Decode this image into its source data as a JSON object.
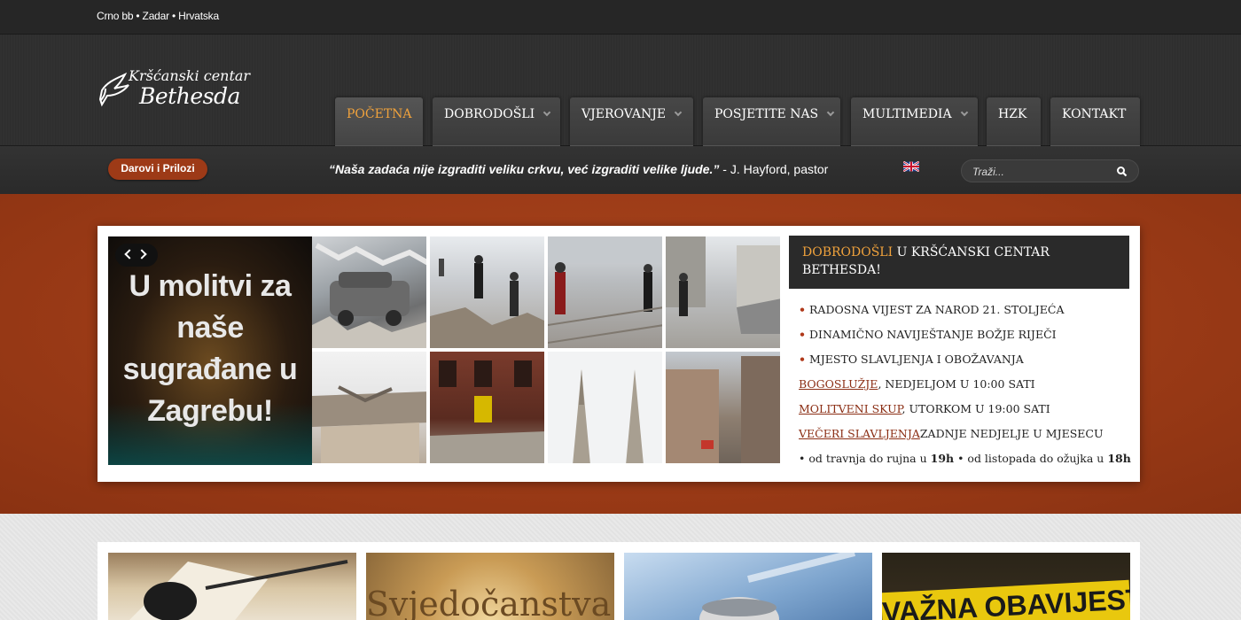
{
  "topbar": {
    "address": "Crno bb • Zadar • Hrvatska"
  },
  "logo": {
    "line1": "Kršćanski centar",
    "line2": "Bethesda"
  },
  "nav": [
    {
      "label": "POČETNA",
      "dropdown": false,
      "active": true
    },
    {
      "label": "DOBRODOŠLI",
      "dropdown": true
    },
    {
      "label": "VJEROVANJE",
      "dropdown": true
    },
    {
      "label": "POSJETITE NAS",
      "dropdown": true
    },
    {
      "label": "MULTIMEDIA",
      "dropdown": true
    },
    {
      "label": "HZK",
      "dropdown": false
    },
    {
      "label": "KONTAKT",
      "dropdown": false
    }
  ],
  "subbar": {
    "donate_label": "Darovi i Prilozi",
    "quote_text": "“Naša zadaća nije izgraditi veliku crkvu, već izgraditi velike ljude.”",
    "quote_author": " - J. Hayford, pastor",
    "language_icon": "uk-flag-icon",
    "search_placeholder": "Traži..."
  },
  "slider": {
    "caption": "U molitvi za naše sugrađane u Zagrebu!"
  },
  "welcome": {
    "title_highlight": "DOBRODOŠLI",
    "title_rest": " U KRŠĆANSKI CENTAR BETHESDA!"
  },
  "info": {
    "bullets": [
      "RADOSNA VIJEST ZA NAROD 21. STOLJEĆA",
      "DINAMIČNO NAVIJEŠTANJE BOŽJE RIJEČI",
      "MJESTO SLAVLJENJA I OBOŽAVANJA"
    ],
    "services": [
      {
        "link": "BOGOSLUŽJE",
        "text": ", NEDJELJOM U 10:00 SATI"
      },
      {
        "link": "MOLITVENI SKUP",
        "text": ", UTORKOM U 19:00 SATI"
      },
      {
        "link": "VEČERI SLAVLJENJA",
        "text": "ZADNJE NEDJELJE U MJESECU"
      }
    ],
    "schedule_a": "• od travnja do rujna u ",
    "schedule_a_time": "19h",
    "schedule_b": " • od listopada do ožujka u ",
    "schedule_b_time": "18h"
  },
  "cards": [
    {
      "title": ""
    },
    {
      "title": "Svjedočanstva!"
    },
    {
      "title": ""
    },
    {
      "title": "VAŽNA OBAVIJEST!"
    }
  ],
  "colors": {
    "accent": "#f0a23c",
    "brand": "#9d3a17",
    "dark": "#2a2a2a"
  }
}
